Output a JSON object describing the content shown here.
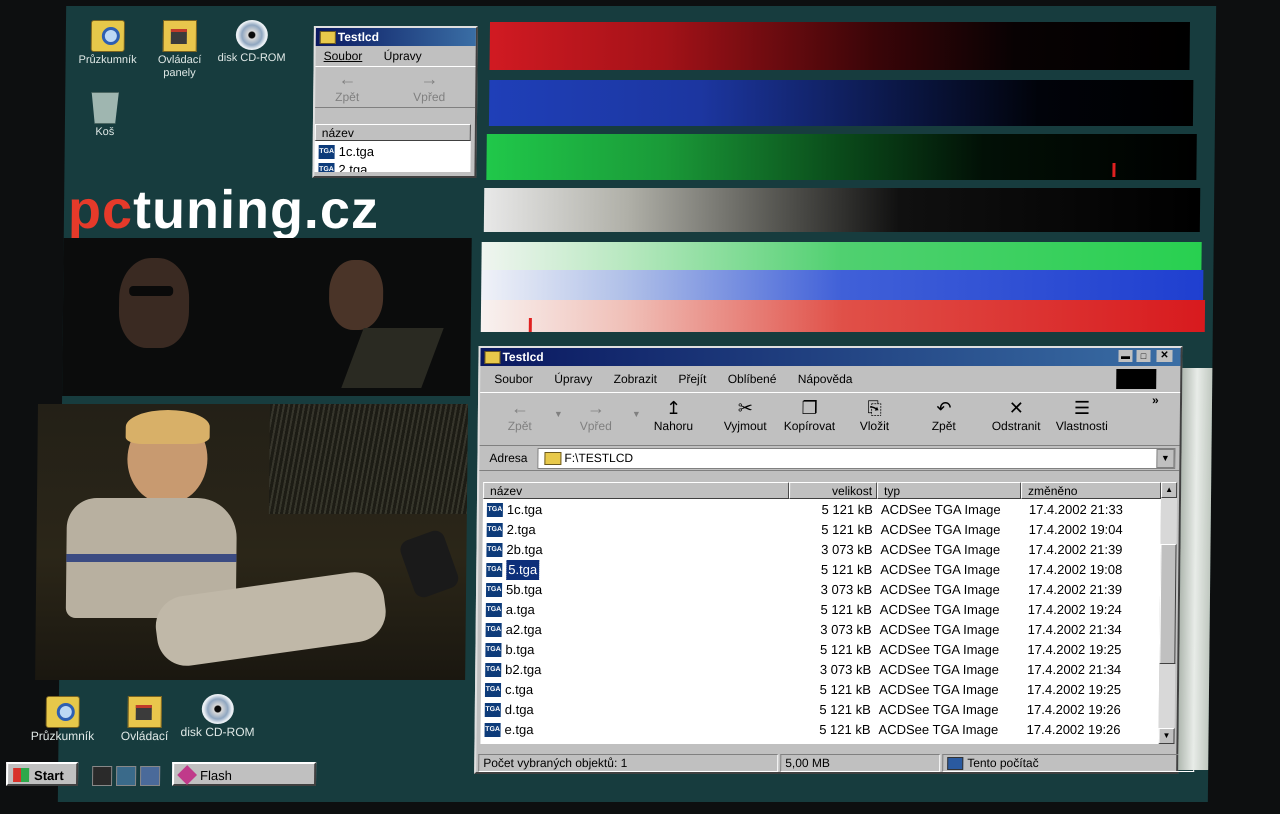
{
  "desktop_top": {
    "icons": [
      {
        "label": "Průzkumník",
        "icon": "explorer-icon"
      },
      {
        "label": "Ovládací panely",
        "icon": "control-panel-icon"
      },
      {
        "label": "disk CD-ROM",
        "icon": "cd-rom-icon"
      },
      {
        "label": "Koš",
        "icon": "recycle-bin-icon"
      }
    ]
  },
  "desktop_bottom": {
    "icons": [
      {
        "label": "Průzkumník",
        "icon": "explorer-icon"
      },
      {
        "label": "Ovládací",
        "icon": "control-panel-icon"
      },
      {
        "label": "disk CD-ROM",
        "icon": "cd-rom-icon"
      }
    ]
  },
  "logo": {
    "pc": "pc",
    "tuning": "tuning.cz"
  },
  "small_window": {
    "title": "Testlcd",
    "menu": [
      "Soubor",
      "Úpravy"
    ],
    "toolbar": {
      "back": "Zpět",
      "forward": "Vpřed"
    },
    "column": "název",
    "files": [
      "1c.tga",
      "2.tga"
    ]
  },
  "main_window": {
    "title": "Testlcd",
    "menu": [
      "Soubor",
      "Úpravy",
      "Zobrazit",
      "Přejít",
      "Oblíbené",
      "Nápověda"
    ],
    "toolbar": {
      "back": "Zpět",
      "forward": "Vpřed",
      "up": "Nahoru",
      "cut": "Vyjmout",
      "copy": "Kopírovat",
      "paste": "Vložit",
      "undo": "Zpět",
      "delete": "Odstranit",
      "properties": "Vlastnosti"
    },
    "address_label": "Adresa",
    "address_value": "F:\\TESTLCD",
    "columns": {
      "name": "název",
      "size": "velikost",
      "type": "typ",
      "modified": "změněno"
    },
    "files": [
      {
        "name": "1c.tga",
        "size": "5 121 kB",
        "type": "ACDSee TGA Image",
        "modified": "17.4.2002 21:33",
        "selected": false
      },
      {
        "name": "2.tga",
        "size": "5 121 kB",
        "type": "ACDSee TGA Image",
        "modified": "17.4.2002 19:04",
        "selected": false
      },
      {
        "name": "2b.tga",
        "size": "3 073 kB",
        "type": "ACDSee TGA Image",
        "modified": "17.4.2002 21:39",
        "selected": false
      },
      {
        "name": "5.tga",
        "size": "5 121 kB",
        "type": "ACDSee TGA Image",
        "modified": "17.4.2002 19:08",
        "selected": true
      },
      {
        "name": "5b.tga",
        "size": "3 073 kB",
        "type": "ACDSee TGA Image",
        "modified": "17.4.2002 21:39",
        "selected": false
      },
      {
        "name": "a.tga",
        "size": "5 121 kB",
        "type": "ACDSee TGA Image",
        "modified": "17.4.2002 19:24",
        "selected": false
      },
      {
        "name": "a2.tga",
        "size": "3 073 kB",
        "type": "ACDSee TGA Image",
        "modified": "17.4.2002 21:34",
        "selected": false
      },
      {
        "name": "b.tga",
        "size": "5 121 kB",
        "type": "ACDSee TGA Image",
        "modified": "17.4.2002 19:25",
        "selected": false
      },
      {
        "name": "b2.tga",
        "size": "3 073 kB",
        "type": "ACDSee TGA Image",
        "modified": "17.4.2002 21:34",
        "selected": false
      },
      {
        "name": "c.tga",
        "size": "5 121 kB",
        "type": "ACDSee TGA Image",
        "modified": "17.4.2002 19:25",
        "selected": false
      },
      {
        "name": "d.tga",
        "size": "5 121 kB",
        "type": "ACDSee TGA Image",
        "modified": "17.4.2002 19:26",
        "selected": false
      },
      {
        "name": "e.tga",
        "size": "5 121 kB",
        "type": "ACDSee TGA Image",
        "modified": "17.4.2002 19:26",
        "selected": false
      }
    ],
    "status": {
      "selected": "Počet vybraných objektů: 1",
      "size": "5,00 MB",
      "location": "Tento počítač"
    }
  },
  "taskbar": {
    "start": "Start",
    "task": "Flash"
  },
  "colors": {
    "desktop": "#173c3e",
    "red": "#d11a22",
    "blue": "#1f3fb8",
    "green": "#20c84a",
    "white": "#e8e8e8",
    "title": "#0a1860"
  }
}
